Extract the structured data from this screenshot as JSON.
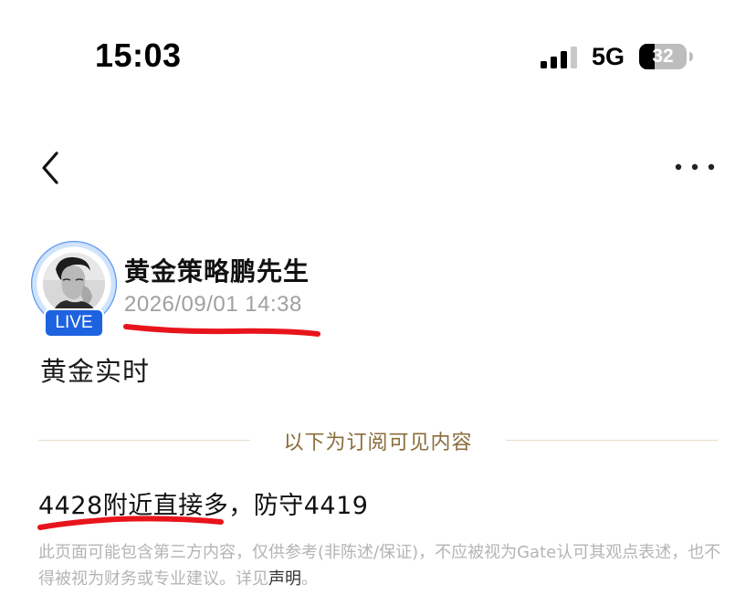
{
  "status_bar": {
    "time": "15:03",
    "network": "5G",
    "battery": "32"
  },
  "nav": {
    "back_icon": "chevron-left-icon",
    "more_icon": "more-horizontal-icon"
  },
  "post": {
    "author_name": "黄金策略鹏先生",
    "live_badge": "LIVE",
    "timestamp": "2026/09/01 14:38",
    "title": "黄金实时",
    "subscriber_divider": "以下为订阅可见内容",
    "content": "4428附近直接多，防守4419",
    "disclaimer_text": "此页面可能包含第三方内容，仅供参考(非陈述/保证)，不应被视为Gate认可其观点表述，也不得被视为财务或专业建议。详见",
    "disclaimer_link": "声明",
    "disclaimer_end": "。"
  },
  "colors": {
    "accent_blue": "#1d63e0",
    "divider_gold": "#8a6d3b",
    "annotation_red": "#e8141c",
    "muted_gray": "#a0a0a0"
  }
}
